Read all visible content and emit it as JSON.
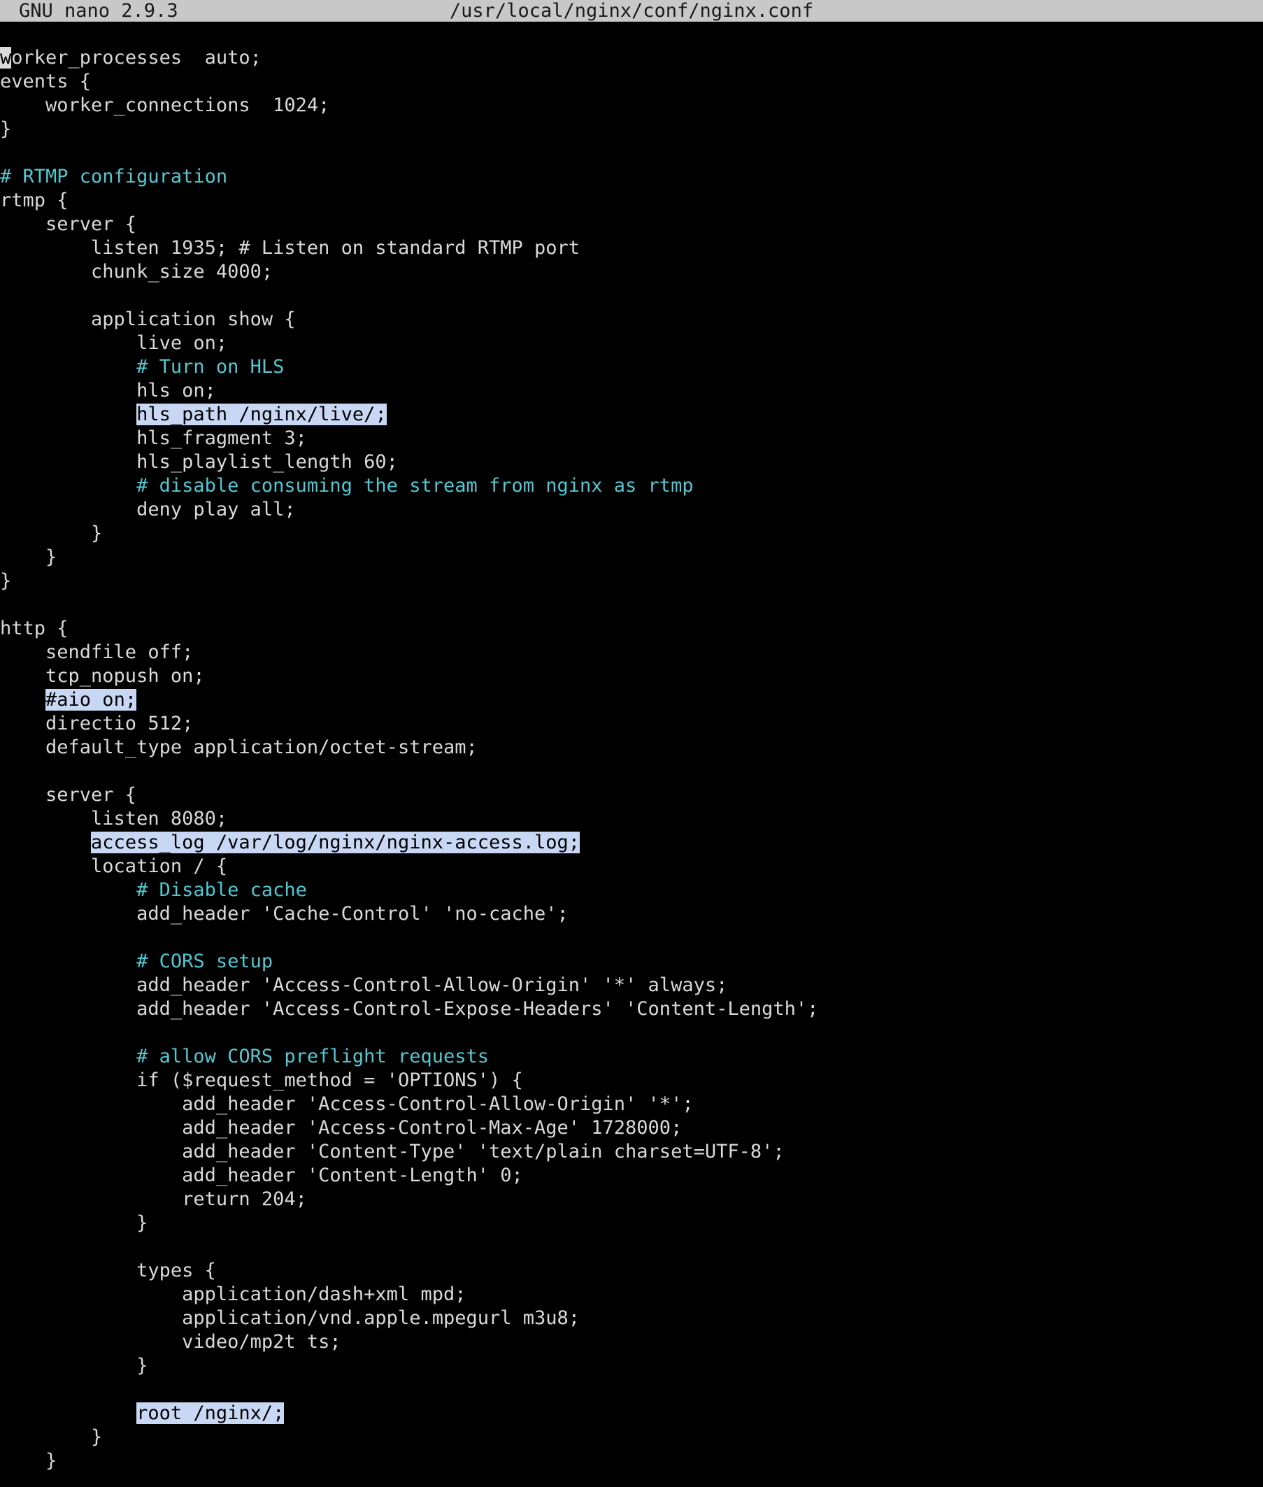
{
  "app": {
    "name": "GNU nano 2.9.3",
    "file_path": "/usr/local/nginx/conf/nginx.conf"
  },
  "colors": {
    "background": "#000000",
    "text": "#d9d9d9",
    "comment": "#52c8d2",
    "selection": "#c8d8f4",
    "titlebar": "#c8c8c8"
  },
  "lines": [
    {
      "text": "worker_processes  auto;",
      "cursor": true
    },
    {
      "text": "events {"
    },
    {
      "text": "    worker_connections  1024;"
    },
    {
      "text": "}"
    },
    {
      "text": ""
    },
    {
      "text": "# RTMP configuration",
      "comment": true
    },
    {
      "text": "rtmp {"
    },
    {
      "text": "    server {"
    },
    {
      "text": "        listen 1935; # Listen on standard RTMP port"
    },
    {
      "text": "        chunk_size 4000;"
    },
    {
      "text": ""
    },
    {
      "text": "        application show {"
    },
    {
      "text": "            live on;"
    },
    {
      "text": "            # Turn on HLS",
      "comment": true
    },
    {
      "text": "            hls on;"
    },
    {
      "text": "            hls_path /nginx/live/;",
      "highlight": true
    },
    {
      "text": "            hls_fragment 3;"
    },
    {
      "text": "            hls_playlist_length 60;"
    },
    {
      "text": "            # disable consuming the stream from nginx as rtmp",
      "comment": true
    },
    {
      "text": "            deny play all;"
    },
    {
      "text": "        }"
    },
    {
      "text": "    }"
    },
    {
      "text": "}"
    },
    {
      "text": ""
    },
    {
      "text": "http {"
    },
    {
      "text": "    sendfile off;"
    },
    {
      "text": "    tcp_nopush on;"
    },
    {
      "text": "    #aio on;",
      "highlight": true
    },
    {
      "text": "    directio 512;"
    },
    {
      "text": "    default_type application/octet-stream;"
    },
    {
      "text": ""
    },
    {
      "text": "    server {"
    },
    {
      "text": "        listen 8080;"
    },
    {
      "text": "        access_log /var/log/nginx/nginx-access.log;",
      "highlight": true
    },
    {
      "text": "        location / {"
    },
    {
      "text": "            # Disable cache",
      "comment": true
    },
    {
      "text": "            add_header 'Cache-Control' 'no-cache';"
    },
    {
      "text": ""
    },
    {
      "text": "            # CORS setup",
      "comment": true
    },
    {
      "text": "            add_header 'Access-Control-Allow-Origin' '*' always;"
    },
    {
      "text": "            add_header 'Access-Control-Expose-Headers' 'Content-Length';"
    },
    {
      "text": ""
    },
    {
      "text": "            # allow CORS preflight requests",
      "comment": true
    },
    {
      "text": "            if ($request_method = 'OPTIONS') {"
    },
    {
      "text": "                add_header 'Access-Control-Allow-Origin' '*';"
    },
    {
      "text": "                add_header 'Access-Control-Max-Age' 1728000;"
    },
    {
      "text": "                add_header 'Content-Type' 'text/plain charset=UTF-8';"
    },
    {
      "text": "                add_header 'Content-Length' 0;"
    },
    {
      "text": "                return 204;"
    },
    {
      "text": "            }"
    },
    {
      "text": ""
    },
    {
      "text": "            types {"
    },
    {
      "text": "                application/dash+xml mpd;"
    },
    {
      "text": "                application/vnd.apple.mpegurl m3u8;"
    },
    {
      "text": "                video/mp2t ts;"
    },
    {
      "text": "            }"
    },
    {
      "text": ""
    },
    {
      "text": "            root /nginx/;",
      "highlight": true
    },
    {
      "text": "        }"
    },
    {
      "text": "    }"
    }
  ]
}
